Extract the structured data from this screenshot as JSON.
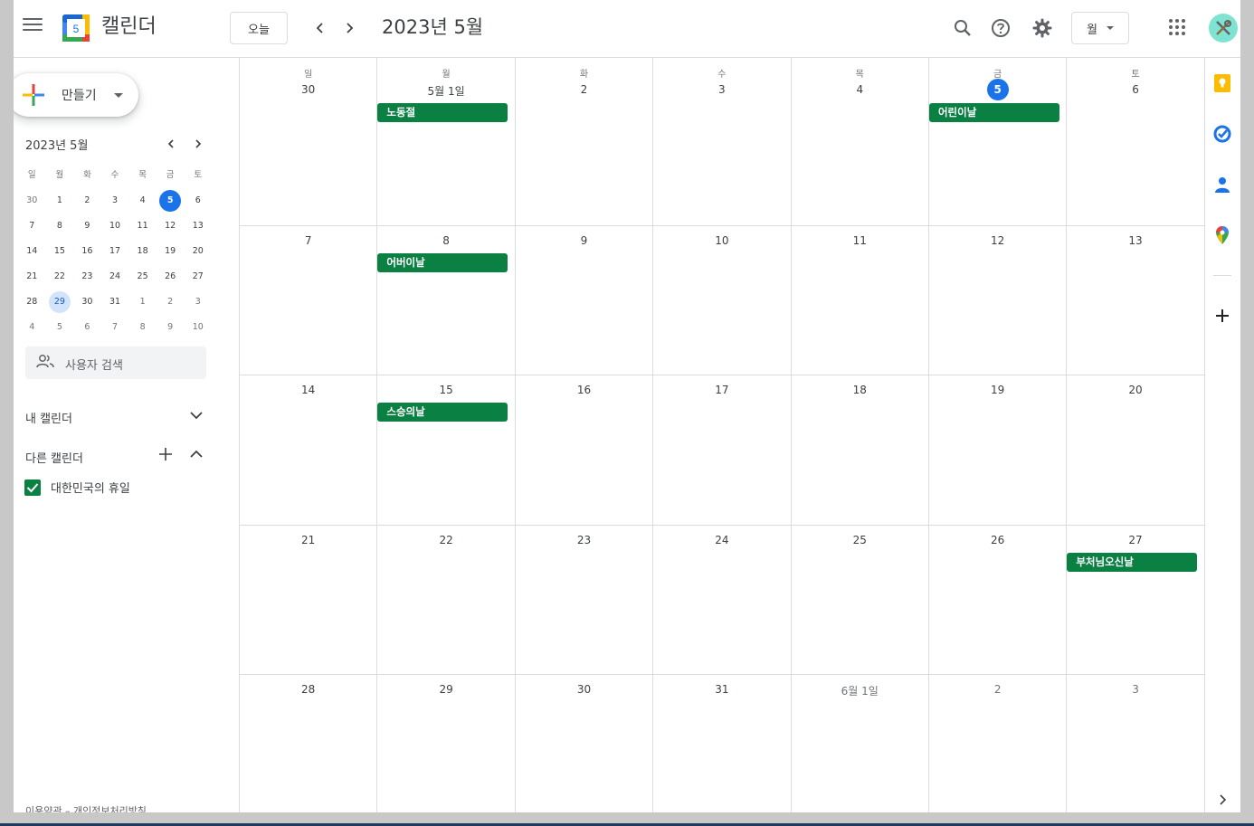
{
  "header": {
    "app_title": "캘린더",
    "logo_day": "5",
    "today_button": "오늘",
    "month_title": "2023년 5월",
    "view_select": "월"
  },
  "sidebar": {
    "create_label": "만들기",
    "mini_calendar": {
      "title": "2023년 5월",
      "weekdays": [
        "일",
        "월",
        "화",
        "수",
        "목",
        "금",
        "토"
      ],
      "weeks": [
        [
          "30",
          "1",
          "2",
          "3",
          "4",
          "5",
          "6"
        ],
        [
          "7",
          "8",
          "9",
          "10",
          "11",
          "12",
          "13"
        ],
        [
          "14",
          "15",
          "16",
          "17",
          "18",
          "19",
          "20"
        ],
        [
          "21",
          "22",
          "23",
          "24",
          "25",
          "26",
          "27"
        ],
        [
          "28",
          "29",
          "30",
          "31",
          "1",
          "2",
          "3"
        ],
        [
          "4",
          "5",
          "6",
          "7",
          "8",
          "9",
          "10"
        ]
      ]
    },
    "search_people_placeholder": "사용자 검색",
    "my_calendars_label": "내 캘린더",
    "other_calendars_label": "다른 캘린더",
    "calendar_items": [
      {
        "label": "대한민국의 휴일",
        "color": "#0b8043",
        "checked": true
      }
    ],
    "footer": "이용약관 – 개인정보처리방침"
  },
  "month_view": {
    "weekdays": [
      "일",
      "월",
      "화",
      "수",
      "목",
      "금",
      "토"
    ],
    "weeks": [
      [
        "30",
        "5월 1일",
        "2",
        "3",
        "4",
        "5",
        "6"
      ],
      [
        "7",
        "8",
        "9",
        "10",
        "11",
        "12",
        "13"
      ],
      [
        "14",
        "15",
        "16",
        "17",
        "18",
        "19",
        "20"
      ],
      [
        "21",
        "22",
        "23",
        "24",
        "25",
        "26",
        "27"
      ],
      [
        "28",
        "29",
        "30",
        "31",
        "6월 1일",
        "2",
        "3"
      ]
    ],
    "events": [
      {
        "week": 0,
        "day": 1,
        "title": "노동절"
      },
      {
        "week": 0,
        "day": 5,
        "title": "어린이날"
      },
      {
        "week": 1,
        "day": 1,
        "title": "어버이날"
      },
      {
        "week": 2,
        "day": 1,
        "title": "스승의날"
      },
      {
        "week": 3,
        "day": 6,
        "title": "부처님오신날"
      }
    ]
  },
  "colors": {
    "accent": "#1a73e8",
    "event": "#0b8043",
    "selected_day": "#d2e3fc"
  }
}
